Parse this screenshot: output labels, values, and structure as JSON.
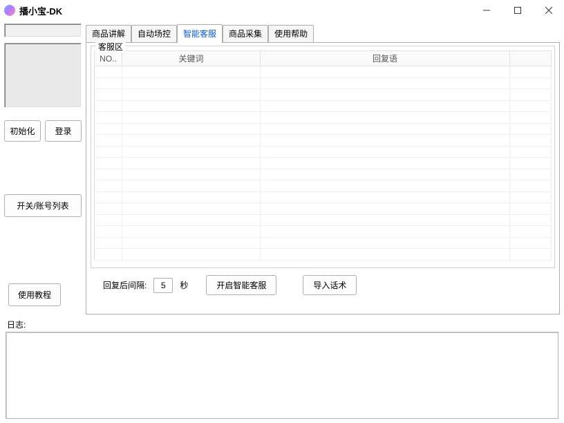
{
  "window": {
    "title": "播小宝-DK"
  },
  "sidebar": {
    "init_btn": "初始化",
    "login_btn": "登录",
    "account_btn": "开关/账号列表",
    "tutorial_btn": "使用教程"
  },
  "tabs": [
    {
      "label": "商品讲解",
      "active": false
    },
    {
      "label": "自动场控",
      "active": false
    },
    {
      "label": "智能客服",
      "active": true
    },
    {
      "label": "商品采集",
      "active": false
    },
    {
      "label": "使用帮助",
      "active": false
    }
  ],
  "service_area": {
    "group_title": "客服区",
    "columns": {
      "no": "NO..",
      "keyword": "关键词",
      "reply": "回复语"
    },
    "rows": []
  },
  "controls": {
    "interval_label_prefix": "回复后间隔:",
    "interval_value": "5",
    "interval_unit": "秒",
    "start_btn": "开启智能客服",
    "import_btn": "导入话术"
  },
  "log": {
    "label": "日志:"
  }
}
